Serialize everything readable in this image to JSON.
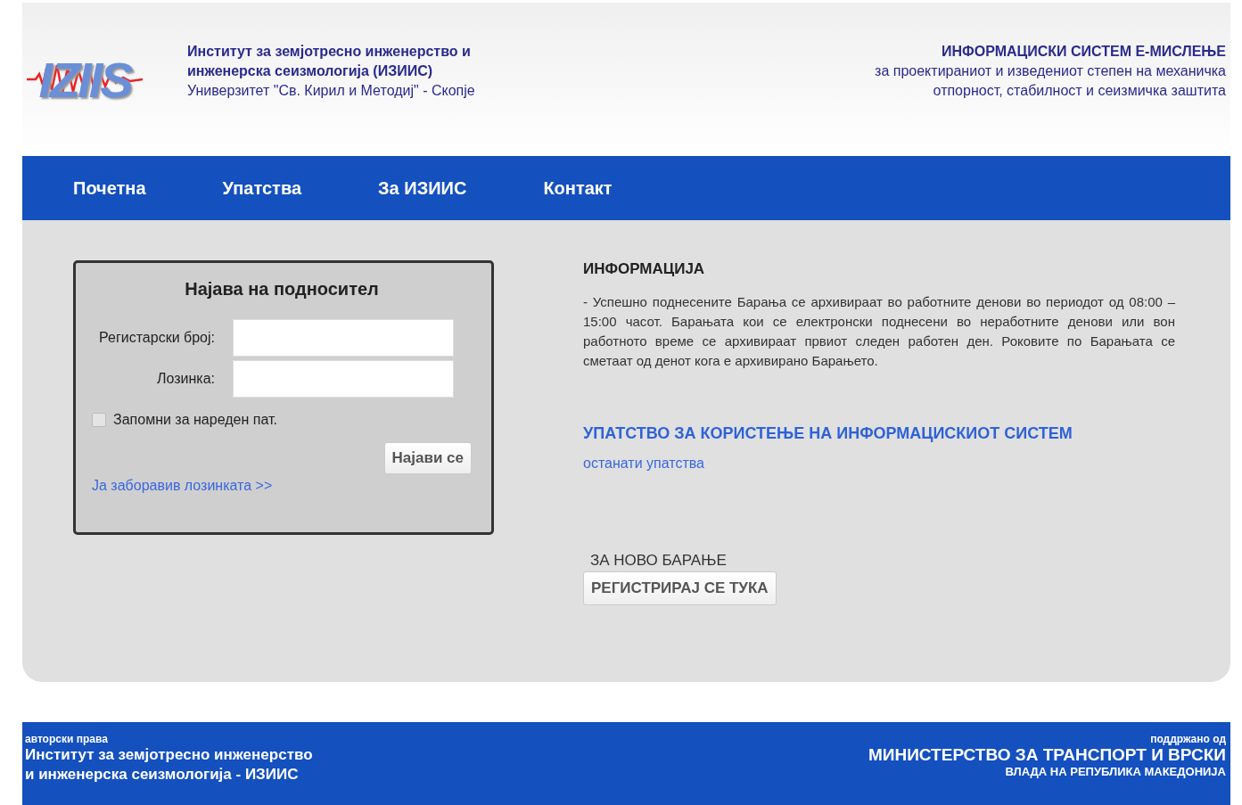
{
  "header": {
    "logo": {
      "text": "IZIIS"
    },
    "institute": {
      "line_1": "Институт за земјотресно инженерство и",
      "line_2": "инженерска сеизмологија (ИЗИИС)",
      "line_3": "Универзитет \"Св. Кирил и Методиј\" - Скопје"
    },
    "system": {
      "title": "ИНФОРМАЦИСКИ СИСТЕМ Е-МИСЛЕЊЕ",
      "line_2": "за проектираниот и изведениот степен на механичка",
      "line_3": "отпорност, стабилност и сеизмичка заштита"
    }
  },
  "nav": [
    {
      "label": "Почетна"
    },
    {
      "label": "Упатства"
    },
    {
      "label": "За ИЗИИС"
    },
    {
      "label": "Контакт"
    }
  ],
  "login": {
    "title": "Најава на подносител",
    "fields": [
      {
        "label": "Регистарски број:"
      },
      {
        "label": "Лозинка:"
      }
    ],
    "remember": {
      "label": "Запомни за нареден пат.",
      "checked": false
    },
    "submit": "Најави се",
    "forgot": "Ја заборавив лозинката >>"
  },
  "info": {
    "heading": "ИНФОРМАЦИЈА",
    "text": "- Успешно поднесените Барања се архивираат во работните денови во периодот од 08:00 – 15:00 часот. Барањата кои се електронски поднесени во неработните денови или вон работното време се архивираат првиот следен работен ден. Роковите по Барањата се сметаат од денот кога е архивирано Барањето.",
    "manual_link": "УПАТСТВО ЗА КОРИСТЕЊЕ НА ИНФОРМАЦИСКИОТ СИСТЕМ",
    "other_link": "останати упатства",
    "new_request_label": "ЗА НОВО БАРАЊЕ",
    "register_button": "РЕГИСТРИРАЈ СЕ ТУКА"
  },
  "footer": {
    "left": {
      "caption": "авторски права",
      "line_1": "Институт за земјотресно инженерство",
      "line_2": "и инженерска сеизмологија - ИЗИИС"
    },
    "right": {
      "caption": "поддржано од",
      "line_1": "МИНИСТЕРСТВО ЗА ТРАНСПОРТ И ВРСКИ",
      "line_2": "ВЛАДА НА РЕПУБЛИКА МАКЕДОНИЈА"
    }
  }
}
